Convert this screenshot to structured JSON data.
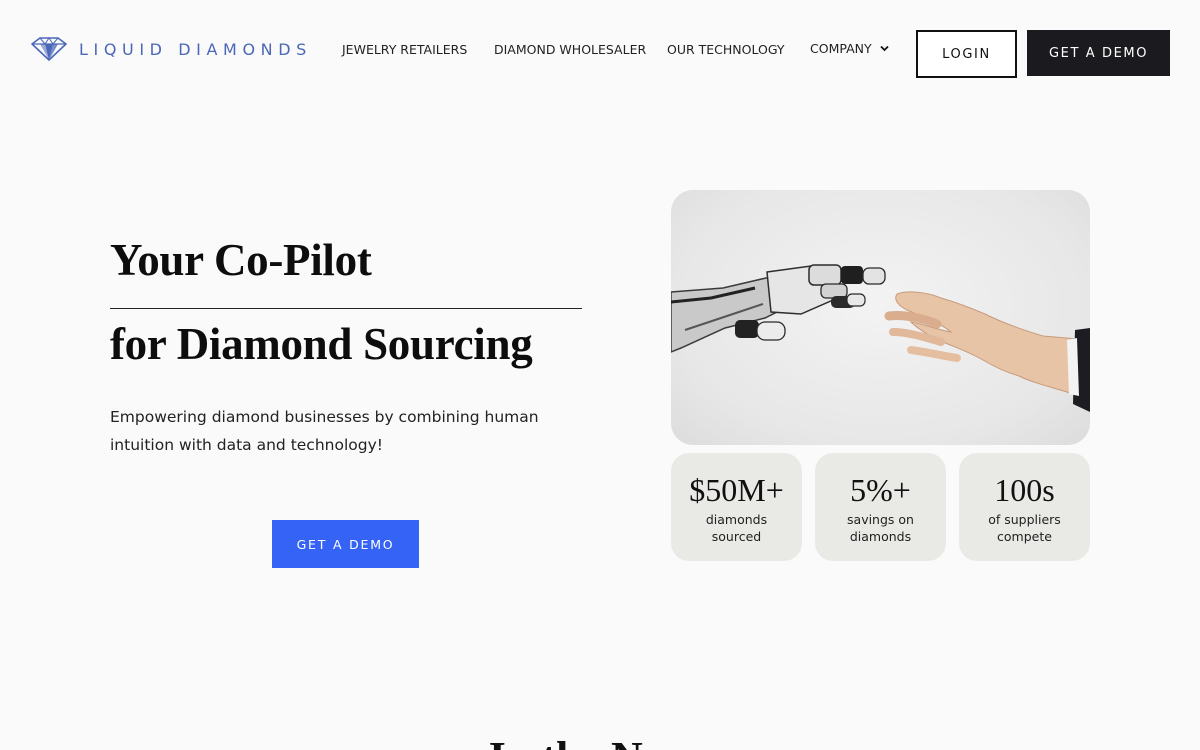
{
  "brand": {
    "name": "LIQUID DIAMONDS",
    "logo_icon": "diamond-icon",
    "color": "#4a67b8"
  },
  "nav": {
    "items": [
      {
        "label": "JEWELRY RETAILERS"
      },
      {
        "label": "DIAMOND WHOLESALER"
      },
      {
        "label": "OUR TECHNOLOGY"
      },
      {
        "label": "COMPANY",
        "icon": "chevron-down-icon"
      }
    ],
    "login_label": "LOGIN",
    "demo_label": "GET A DEMO"
  },
  "hero": {
    "title_line1": "Your Co-Pilot",
    "title_line2": "for Diamond Sourcing",
    "description": "Empowering diamond businesses by combining human intuition with data and technology!",
    "cta_label": "GET A DEMO",
    "cta_color": "#3563f6",
    "image_alt": "robot-hand-reaching-human-hand"
  },
  "stats": [
    {
      "value": "$50M+",
      "label": "diamonds sourced"
    },
    {
      "value": "5%+",
      "label": "savings on diamonds"
    },
    {
      "value": "100s",
      "label": "of suppliers compete"
    }
  ],
  "next_section": {
    "heading_peek": "In the News"
  }
}
